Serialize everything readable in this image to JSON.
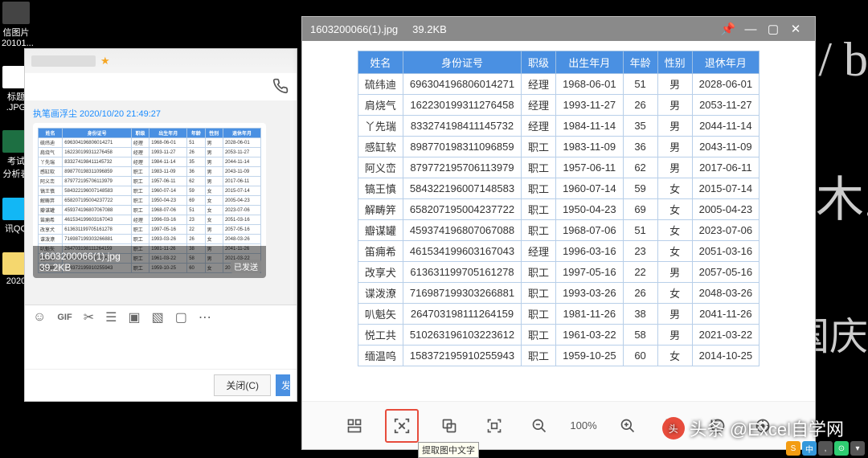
{
  "desktop": {
    "icon1": "信图片\n20101...",
    "icon2": "标题\n.JPG",
    "icon3": "考试\n分析表",
    "icon4": "讯QQ",
    "icon5": "2020"
  },
  "chat": {
    "contact": "　",
    "timestamp": "执笔画浮尘 2020/10/20 21:49:27",
    "thumb_filename": "1603200066(1).jpg",
    "thumb_size": "39.2KB",
    "sent_label": "已发送",
    "close_btn": "关闭(C)",
    "send_btn": "发"
  },
  "viewer": {
    "filename": "1603200066(1).jpg",
    "filesize": "39.2KB",
    "zoom": "100%",
    "ocr_tooltip": "提取图中文字",
    "headers": [
      "姓名",
      "身份证号",
      "职级",
      "出生年月",
      "年龄",
      "性别",
      "退休年月"
    ],
    "rows": [
      [
        "硫纬迪",
        "696304196806014271",
        "经理",
        "1968-06-01",
        "51",
        "男",
        "2028-06-01"
      ],
      [
        "肩烧气",
        "162230199311276458",
        "经理",
        "1993-11-27",
        "26",
        "男",
        "2053-11-27"
      ],
      [
        "丫先瑞",
        "833274198411145732",
        "经理",
        "1984-11-14",
        "35",
        "男",
        "2044-11-14"
      ],
      [
        "感缸软",
        "898770198311096859",
        "职工",
        "1983-11-09",
        "36",
        "男",
        "2043-11-09"
      ],
      [
        "阿义峦",
        "879772195706113979",
        "职工",
        "1957-06-11",
        "62",
        "男",
        "2017-06-11"
      ],
      [
        "镐王慎",
        "584322196007148583",
        "职工",
        "1960-07-14",
        "59",
        "女",
        "2015-07-14"
      ],
      [
        "解畴笄",
        "658207195004237722",
        "职工",
        "1950-04-23",
        "69",
        "女",
        "2005-04-23"
      ],
      [
        "瓣谋罐",
        "459374196807067088",
        "职工",
        "1968-07-06",
        "51",
        "女",
        "2023-07-06"
      ],
      [
        "笛痈希",
        "461534199603167043",
        "经理",
        "1996-03-16",
        "23",
        "女",
        "2051-03-16"
      ],
      [
        "改享犬",
        "613631199705161278",
        "职工",
        "1997-05-16",
        "22",
        "男",
        "2057-05-16"
      ],
      [
        "谍泼潦",
        "716987199303266881",
        "职工",
        "1993-03-26",
        "26",
        "女",
        "2048-03-26"
      ],
      [
        "叭魁矢",
        "264703198111264159",
        "职工",
        "1981-11-26",
        "38",
        "男",
        "2041-11-26"
      ],
      [
        "悦工共",
        "510263196103223612",
        "职工",
        "1961-03-22",
        "58",
        "男",
        "2021-03-22"
      ],
      [
        "缅温呜",
        "158372195910255943",
        "职工",
        "1959-10-25",
        "60",
        "女",
        "2014-10-25"
      ]
    ]
  },
  "watermark": "头条 @Excel自学网",
  "side_text": "国庆"
}
